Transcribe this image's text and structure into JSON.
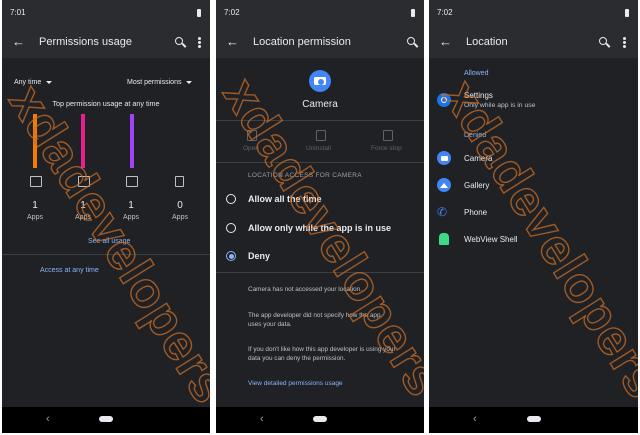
{
  "colors": {
    "background": "#202124",
    "bar": "#2b2c2f",
    "accent": "#8ab4f8",
    "bar_orange": "#f57c00",
    "bar_pink": "#e91e90",
    "bar_purple": "#a142f4"
  },
  "watermark": "xdadevelopers",
  "panel1": {
    "time": "7:01",
    "title": "Permissions usage",
    "icons": [
      "back-arrow-icon",
      "search-icon",
      "overflow-menu-icon"
    ],
    "filter_time": "Any time",
    "filter_sort": "Most permissions",
    "chart_title": "Top permission usage at any time",
    "permissions": [
      {
        "icon": "phone-icon",
        "count": "1",
        "unit": "Apps",
        "usage": 1.0
      },
      {
        "icon": "contacts-icon",
        "count": "1",
        "unit": "Apps",
        "usage": 1.0
      },
      {
        "icon": "sms-icon",
        "count": "1",
        "unit": "Apps",
        "usage": 1.0
      },
      {
        "icon": "storage-icon",
        "count": "0",
        "unit": "Apps",
        "usage": 0
      }
    ],
    "see_all": "See all usage",
    "access_any_time": "Access at any time"
  },
  "panel2": {
    "time": "7:02",
    "title": "Location permission",
    "app_name": "Camera",
    "actions": [
      {
        "icon": "open-icon",
        "label": "Open"
      },
      {
        "icon": "uninstall-icon",
        "label": "Uninstall"
      },
      {
        "icon": "force-stop-icon",
        "label": "Force stop"
      }
    ],
    "section_header": "LOCATION ACCESS FOR CAMERA",
    "options": [
      {
        "label": "Allow all the time",
        "selected": false
      },
      {
        "label": "Allow only while the app is in use",
        "selected": false
      },
      {
        "label": "Deny",
        "selected": true
      }
    ],
    "note1": "Camera has not accessed your location.",
    "note2": "The app developer did not specify how the app uses your data.",
    "note3": "If you don't like how this app developer is using your data you can deny the permission.",
    "link": "View detailed permissions usage"
  },
  "panel3": {
    "time": "7:02",
    "title": "Location",
    "allowed_header": "Allowed",
    "allowed": [
      {
        "icon": "settings-gear-icon",
        "name": "Settings",
        "sub": "Only while app is in use"
      }
    ],
    "denied_header": "Denied",
    "denied": [
      {
        "icon": "camera-icon",
        "name": "Camera"
      },
      {
        "icon": "gallery-icon",
        "name": "Gallery"
      },
      {
        "icon": "phone-icon",
        "name": "Phone"
      },
      {
        "icon": "android-icon",
        "name": "WebView Shell"
      }
    ]
  }
}
